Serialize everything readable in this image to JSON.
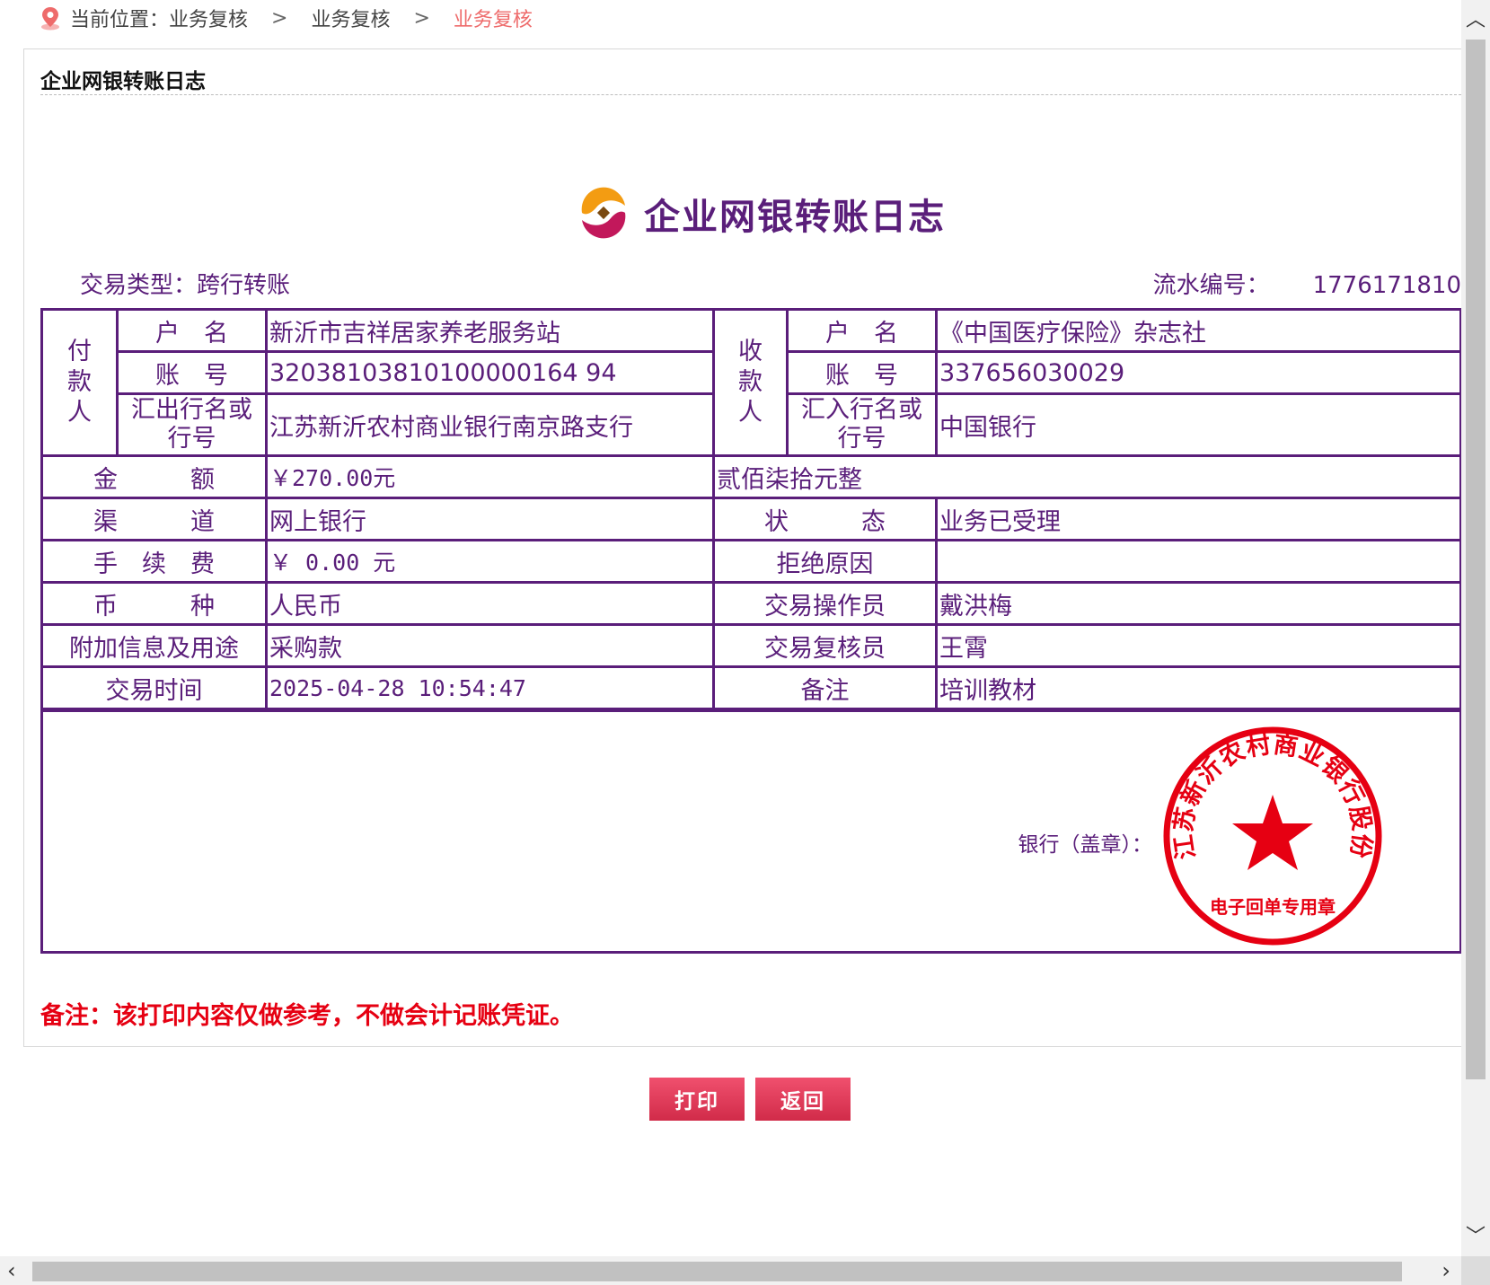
{
  "breadcrumb": {
    "prefix": "当前位置：业务复核",
    "level2": "业务复核",
    "current": "业务复核",
    "separator": ">"
  },
  "panel": {
    "title": "企业网银转账日志"
  },
  "document": {
    "title": "企业网银转账日志",
    "transaction_type": "交易类型：跨行转账",
    "serial_label": "流水编号：",
    "serial_number": "1776171810"
  },
  "payer": {
    "side_label": "付款人",
    "name_label": "户　名",
    "name": "新沂市吉祥居家养老服务站",
    "account_label": "账　号",
    "account": "32038103810100000164 94",
    "bank_label": "汇出行名或行号",
    "bank": "江苏新沂农村商业银行南京路支行"
  },
  "payee": {
    "side_label": "收款人",
    "name_label": "户　名",
    "name": "《中国医疗保险》杂志社",
    "account_label": "账　号",
    "account": "337656030029",
    "bank_label": "汇入行名或行号",
    "bank": "中国银行"
  },
  "rows": {
    "amount_label": "金　　　额",
    "amount": "￥270.00元",
    "amount_upper": "贰佰柒拾元整",
    "channel_label": "渠　　　道",
    "channel": "网上银行",
    "status_label": "状　　　态",
    "status": "业务已受理",
    "fee_label": "手　续　费",
    "fee": "￥ 0.00 元",
    "reject_label": "拒绝原因",
    "reject": "",
    "currency_label": "币　　　种",
    "currency": "人民币",
    "operator_label": "交易操作员",
    "operator": "戴洪梅",
    "purpose_label": "附加信息及用途",
    "purpose": "采购款",
    "reviewer_label": "交易复核员",
    "reviewer": "王霄",
    "time_label": "交易时间",
    "time": "2025-04-28 10:54:47",
    "remark_label": "备注",
    "remark": "培训教材"
  },
  "stamp": {
    "label": "银行（盖章）：",
    "seal_text": "江苏新沂农村商业银行股份有限公司",
    "seal_subtext": "电子回单专用章",
    "seal_color": "#e60012"
  },
  "note": "备注：该打印内容仅做参考，不做会计记账凭证。",
  "buttons": {
    "print": "打印",
    "back": "返回"
  },
  "colors": {
    "accent": "#5a1e7a",
    "button": "#e03a58",
    "breadcrumb_current": "#ee6b6b"
  }
}
